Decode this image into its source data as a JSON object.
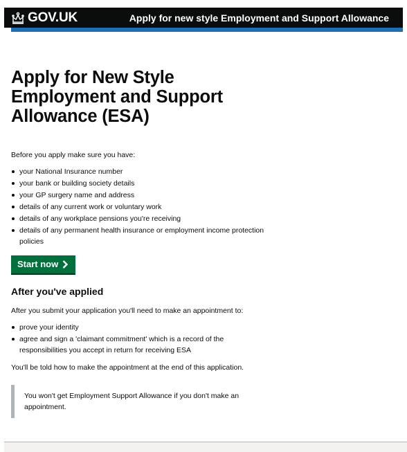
{
  "header": {
    "logo_text": "GOV.UK",
    "service_name": "Apply for new style Employment and Support Allowance"
  },
  "page": {
    "title": "Apply for New Style Employment and Support Allowance (ESA)",
    "intro": "Before you apply make sure you have:",
    "requirements": [
      "your National Insurance number",
      "your bank or building society details",
      "your GP surgery name and address",
      "details of any current work or voluntary work",
      "details of any workplace pensions you're receiving",
      "details of any permanent health insurance or employment income protection policies"
    ],
    "start_button_label": "Start now",
    "after_heading": "After you've applied",
    "after_intro": "After you submit your application you'll need to make an appointment to:",
    "after_items": [
      "prove your identity",
      "agree and sign a 'claimant commitment' which is a record of the responsibilities you accept in return for receiving ESA"
    ],
    "told_text": "You'll be told how to make the appointment at the end of this application.",
    "inset_text": "You won't get Employment Support Allowance if you don't make an appointment."
  },
  "colors": {
    "header_bg": "#0b0c0c",
    "accent_blue": "#1d70b8",
    "button_green": "#00703c",
    "inset_border": "#b1b4b6"
  },
  "icons": {
    "logo": "crown-icon",
    "start_button": "chevron-right-icon"
  }
}
